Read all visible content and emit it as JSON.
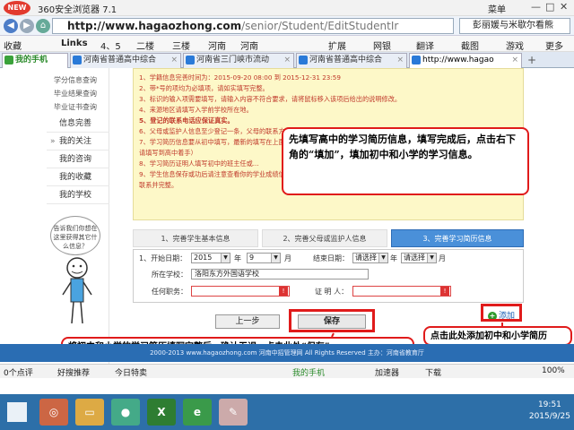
{
  "browser": {
    "logo_text": "NEW",
    "title": "360安全浏览器 7.1",
    "menu_label": "菜单",
    "url_host": "http://www.hagaozhong.com",
    "url_path": "/senior/Student/EditStudentIr",
    "search_text": "彭丽媛与米歇尔看熊",
    "favorites": [
      "收藏",
      "Links",
      "4、5",
      "二楼",
      "三楼",
      "河南",
      "河南",
      "扩展",
      "网银",
      "翻译",
      "截图",
      "游戏",
      "更多"
    ],
    "tabs": [
      "我的手机",
      "河南省普通高中综合",
      "河南省三门峡市流动",
      "河南省普通高中综合",
      "http://www.hagao"
    ]
  },
  "sidebar": {
    "top_links": [
      "学分信息查询",
      "毕业结果查询",
      "毕业证书查询"
    ],
    "items": [
      "信息完善",
      "我的关注",
      "我的咨询",
      "我的收藏",
      "我的学校"
    ],
    "helper_text": "告诉我们你想在这里获得其它什么信息？"
  },
  "notice": {
    "lines": [
      "1、学籍信息完善时间为：2015-09-20 08:00 到 2015-12-31 23:59",
      "2、带*号的项均为必填项，请如实填写完整。",
      "3、标识的输入项需要填写，请输入内容不符合要求，请将鼠标移入该项后给出的说明修改。",
      "4、来源地区请填写入学前学校所在地。",
      "5、登记的联系电话应保证真实。",
      "6、父母或监护人信息至少登记一条，父母的联系方式...",
      "7、学习简历信息要从初中填写，最新的填写在上面...",
      "   请填写到高中着手）",
      "8、学习简历证明人填写初中的班主任或...",
      "9、学生信息保存或功后请注意查看你的学业成绩信息，综合素质评价信息及学业学分信息是否完整，如有遗缺请及时与学校",
      "   联系并完整。"
    ]
  },
  "steps": [
    "1、完善学生基本信息",
    "2、完善父母或监护人信息",
    "3、完善学习简历信息"
  ],
  "form": {
    "start_label": "1、开始日期：",
    "start_year": "2015",
    "year_unit": "年",
    "start_month": "9",
    "month_unit": "月",
    "end_label": "结束日期：",
    "end_year": "请选择",
    "end_month": "请选择",
    "school_label": "所在学校：",
    "school_value": "洛阳东方外国语学校",
    "position_label": "任何职务：",
    "witness_label": "证 明 人：",
    "prev_button": "上一步",
    "save_button": "保存",
    "add_link": "添加"
  },
  "callouts": {
    "main": "先填写高中的学习简历信息，填写完成后，点击右下角的“填加”，填加初中和小学的学习信息。",
    "add": "点击此处添加初中和小学简历",
    "save": "将初中和小学的学习简历填写完整后，确认无误，点击此处“保存”"
  },
  "footer": {
    "text": "2000-2013 www.hagaozhong.com 河南中招管理网 All Rights Reserved 主办：河南省教育厅"
  },
  "statusbar": {
    "left_items": [
      "0个点评",
      "好搜推荐",
      "今日特卖"
    ],
    "right_items": [
      "我的手机",
      "加速器",
      "下载"
    ],
    "zoom": "100%"
  },
  "taskbar": {
    "time": "19:51",
    "date": "2015/9/25"
  },
  "colors": {
    "accent_red": "#e01b1b",
    "notice_bg": "#fdf8c8",
    "footer_bg": "#2a6db3",
    "step_active": "#4a90d9"
  }
}
